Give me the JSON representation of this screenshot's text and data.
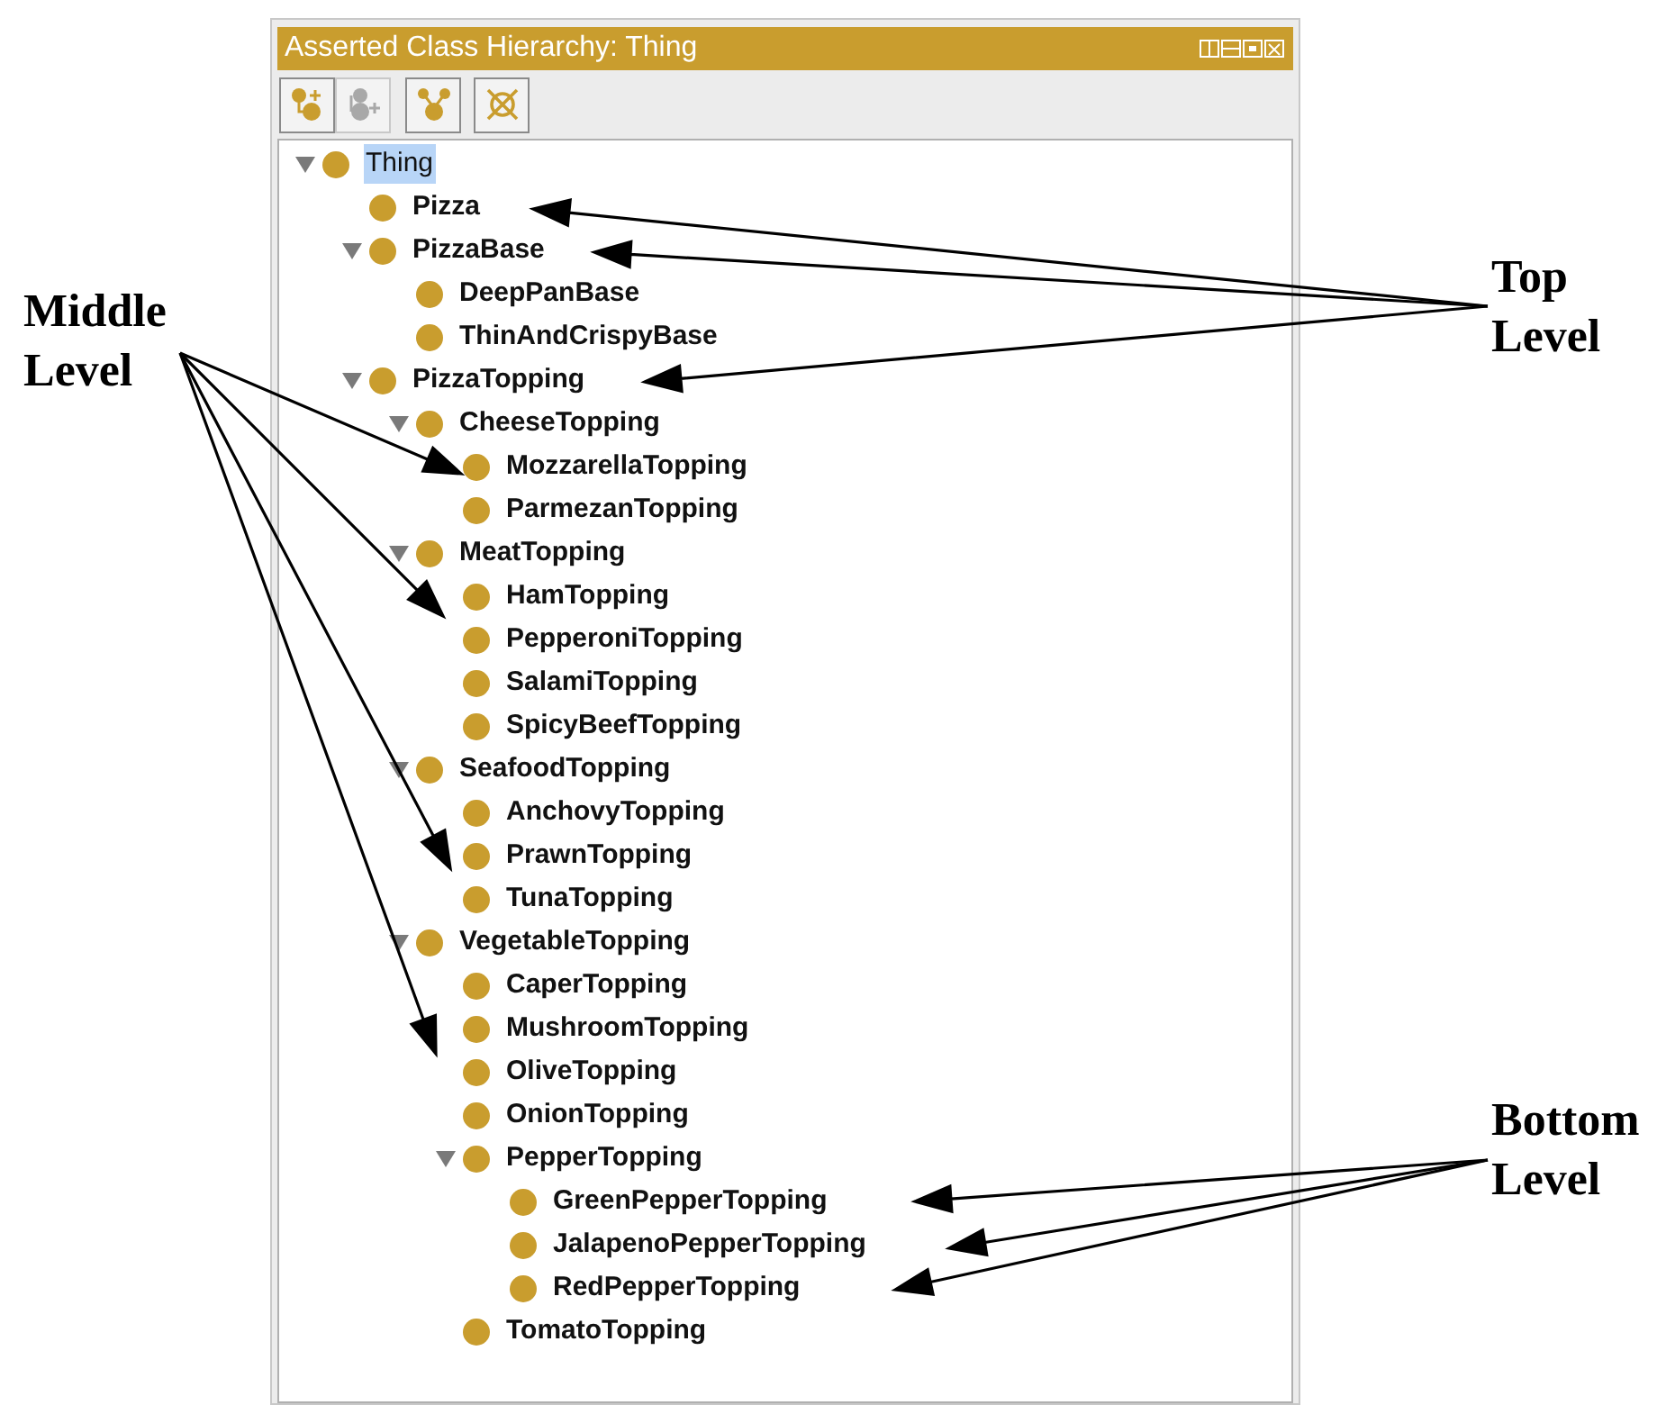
{
  "annotations": {
    "middle_label": "Middle Level",
    "top_label": "Top Level",
    "bottom_label": "Bottom Level"
  },
  "panel": {
    "title": "Asserted Class Hierarchy: Thing",
    "toolbar": [
      {
        "kind": "add-subclass",
        "disabled": false
      },
      {
        "kind": "add-sibling",
        "disabled": true
      },
      {
        "kind": "branch",
        "disabled": false
      },
      {
        "kind": "delete",
        "disabled": false
      }
    ],
    "tree": [
      {
        "label": "Thing",
        "selected": true,
        "expanded": true,
        "children": [
          {
            "label": "Pizza",
            "selected": false
          },
          {
            "label": "PizzaBase",
            "selected": false,
            "expanded": true,
            "children": [
              {
                "label": "DeepPanBase",
                "selected": false
              },
              {
                "label": "ThinAndCrispyBase",
                "selected": false
              }
            ]
          },
          {
            "label": "PizzaTopping",
            "selected": false,
            "expanded": true,
            "children": [
              {
                "label": "CheeseTopping",
                "selected": false,
                "expanded": true,
                "children": [
                  {
                    "label": "MozzarellaTopping",
                    "selected": false
                  },
                  {
                    "label": "ParmezanTopping",
                    "selected": false
                  }
                ]
              },
              {
                "label": "MeatTopping",
                "selected": false,
                "expanded": true,
                "children": [
                  {
                    "label": "HamTopping",
                    "selected": false
                  },
                  {
                    "label": "PepperoniTopping",
                    "selected": false
                  },
                  {
                    "label": "SalamiTopping",
                    "selected": false
                  },
                  {
                    "label": "SpicyBeefTopping",
                    "selected": false
                  }
                ]
              },
              {
                "label": "SeafoodTopping",
                "selected": false,
                "expanded": true,
                "children": [
                  {
                    "label": "AnchovyTopping",
                    "selected": false
                  },
                  {
                    "label": "PrawnTopping",
                    "selected": false
                  },
                  {
                    "label": "TunaTopping",
                    "selected": false
                  }
                ]
              },
              {
                "label": "VegetableTopping",
                "selected": false,
                "expanded": true,
                "children": [
                  {
                    "label": "CaperTopping",
                    "selected": false
                  },
                  {
                    "label": "MushroomTopping",
                    "selected": false
                  },
                  {
                    "label": "OliveTopping",
                    "selected": false
                  },
                  {
                    "label": "OnionTopping",
                    "selected": false
                  },
                  {
                    "label": "PepperTopping",
                    "selected": false,
                    "expanded": true,
                    "children": [
                      {
                        "label": "GreenPepperTopping",
                        "selected": false
                      },
                      {
                        "label": "JalapenoPepperTopping",
                        "selected": false
                      },
                      {
                        "label": "RedPepperTopping",
                        "selected": false
                      }
                    ]
                  },
                  {
                    "label": "TomatoTopping",
                    "selected": false
                  }
                ]
              }
            ]
          }
        ]
      }
    ]
  }
}
